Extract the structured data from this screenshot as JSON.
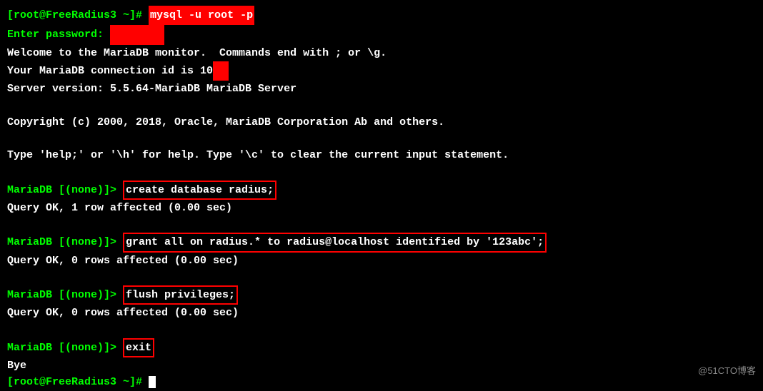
{
  "terminal": {
    "lines": [
      {
        "id": "line1",
        "parts": [
          {
            "text": "[root@FreeRadius3 ~]# ",
            "class": "green"
          },
          {
            "text": "mysql -u root -p",
            "class": "red-highlight"
          }
        ]
      },
      {
        "id": "line2",
        "parts": [
          {
            "text": "Enter password: ",
            "class": "green"
          },
          {
            "text": "        ",
            "class": "red-highlight"
          }
        ]
      },
      {
        "id": "line3",
        "parts": [
          {
            "text": "Welcome to the MariaDB monitor.  Commands end with ; or \\g.",
            "class": "white"
          }
        ]
      },
      {
        "id": "line4",
        "parts": [
          {
            "text": "Your MariaDB connection id is 10",
            "class": "white"
          },
          {
            "text": "  ",
            "class": "red-highlight"
          }
        ]
      },
      {
        "id": "line5",
        "parts": [
          {
            "text": "Server version: 5.5.64-MariaDB MariaDB Server",
            "class": "white"
          }
        ]
      },
      {
        "id": "line6",
        "parts": [
          {
            "text": "",
            "class": ""
          }
        ]
      },
      {
        "id": "line7",
        "parts": [
          {
            "text": "Copyright (c) 2000, 2018, Oracle, MariaDB Corporation Ab and others.",
            "class": "white"
          }
        ]
      },
      {
        "id": "line8",
        "parts": [
          {
            "text": "",
            "class": ""
          }
        ]
      },
      {
        "id": "line9",
        "parts": [
          {
            "text": "Type 'help;' or '\\h' for help. Type '\\c' to clear the current input statement.",
            "class": "white"
          }
        ]
      },
      {
        "id": "line10",
        "parts": [
          {
            "text": "",
            "class": ""
          }
        ]
      },
      {
        "id": "line11",
        "parts": [
          {
            "text": "MariaDB [(none)]> ",
            "class": "green"
          },
          {
            "text": "create database radius;",
            "class": "cmd-highlight"
          }
        ]
      },
      {
        "id": "line12",
        "parts": [
          {
            "text": "Query OK, 1 row affected (0.00 sec)",
            "class": "white"
          }
        ]
      },
      {
        "id": "line13",
        "parts": [
          {
            "text": "",
            "class": ""
          }
        ]
      },
      {
        "id": "line14",
        "parts": [
          {
            "text": "MariaDB [(none)]> ",
            "class": "green"
          },
          {
            "text": "grant all on radius.* to radius@localhost identified by '123abc';",
            "class": "cmd-highlight"
          }
        ]
      },
      {
        "id": "line15",
        "parts": [
          {
            "text": "Query OK, 0 rows affected (0.00 sec)",
            "class": "white"
          }
        ]
      },
      {
        "id": "line16",
        "parts": [
          {
            "text": "",
            "class": ""
          }
        ]
      },
      {
        "id": "line17",
        "parts": [
          {
            "text": "MariaDB [(none)]> ",
            "class": "green"
          },
          {
            "text": "flush privileges;",
            "class": "cmd-highlight"
          }
        ]
      },
      {
        "id": "line18",
        "parts": [
          {
            "text": "Query OK, 0 rows affected (0.00 sec)",
            "class": "white"
          }
        ]
      },
      {
        "id": "line19",
        "parts": [
          {
            "text": "",
            "class": ""
          }
        ]
      },
      {
        "id": "line20",
        "parts": [
          {
            "text": "MariaDB [(none)]> ",
            "class": "green"
          },
          {
            "text": "exit",
            "class": "cmd-highlight"
          }
        ]
      },
      {
        "id": "line21",
        "parts": [
          {
            "text": "Bye",
            "class": "white"
          }
        ]
      },
      {
        "id": "line22",
        "parts": [
          {
            "text": "[root@FreeRadius3 ~]# ",
            "class": "green"
          },
          {
            "text": "cursor",
            "class": "cursor-block"
          }
        ]
      }
    ],
    "watermark": "@51CTO博客"
  }
}
